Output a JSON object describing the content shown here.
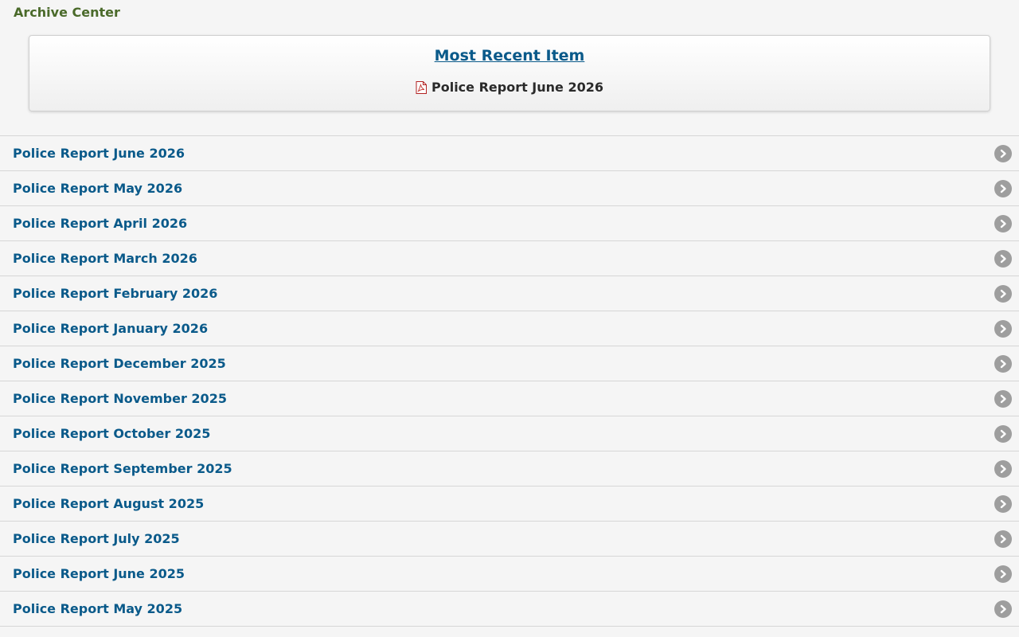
{
  "header": {
    "title": "Archive Center"
  },
  "recent": {
    "title": "Most Recent Item",
    "item_label": "Police Report June 2026",
    "item_icon": "pdf-icon"
  },
  "list": {
    "items": [
      {
        "label": "Police Report June 2026"
      },
      {
        "label": "Police Report May 2026"
      },
      {
        "label": "Police Report April 2026"
      },
      {
        "label": "Police Report March 2026"
      },
      {
        "label": "Police Report February 2026"
      },
      {
        "label": "Police Report January 2026"
      },
      {
        "label": "Police Report December 2025"
      },
      {
        "label": "Police Report November 2025"
      },
      {
        "label": "Police Report October 2025"
      },
      {
        "label": "Police Report September 2025"
      },
      {
        "label": "Police Report August 2025"
      },
      {
        "label": "Police Report July 2025"
      },
      {
        "label": "Police Report June 2025"
      },
      {
        "label": "Police Report May 2025"
      }
    ],
    "item_icon": "chevron-right-circle-icon"
  },
  "colors": {
    "header_text": "#4a6a2a",
    "link": "#0a5a8a",
    "arrow_bg": "#9e9e9e"
  }
}
